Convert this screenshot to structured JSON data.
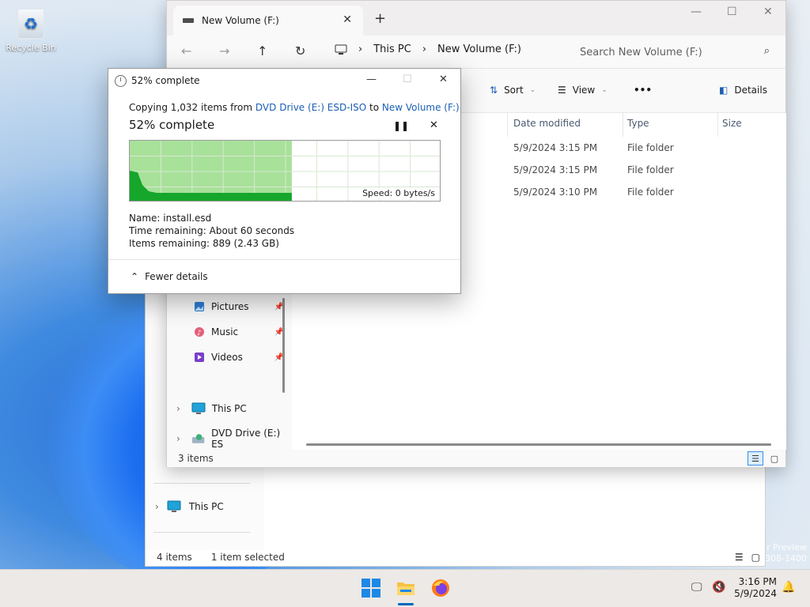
{
  "desktop": {
    "recycle_bin_label": "Recycle Bin",
    "watermark_line1": "r Preview",
    "watermark_line2": "0308-1400"
  },
  "back_window": {
    "sidebar_this_pc": "This PC",
    "status_items": "4 items",
    "status_selected": "1 item selected"
  },
  "explorer": {
    "tab_title": "New Volume (F:)",
    "new_tab_symbol": "+",
    "breadcrumb": [
      "This PC",
      "New Volume (F:)"
    ],
    "search_placeholder": "Search New Volume (F:)",
    "toolbar": {
      "sort_label": "Sort",
      "view_label": "View",
      "more_label": "•••",
      "details_label": "Details"
    },
    "columns": [
      "Date modified",
      "Type",
      "Size"
    ],
    "rows": [
      {
        "date": "5/9/2024 3:15 PM",
        "type": "File folder"
      },
      {
        "date": "5/9/2024 3:15 PM",
        "type": "File folder"
      },
      {
        "date": "5/9/2024 3:10 PM",
        "type": "File folder"
      }
    ],
    "sidebar": {
      "pinned": [
        "Pictures",
        "Music",
        "Videos"
      ],
      "this_pc": "This PC",
      "dvd_drive": "DVD Drive (E:) ES"
    },
    "status_count": "3 items"
  },
  "dialog": {
    "title": "52% complete",
    "copy_prefix": "Copying 1,032 items from ",
    "source": "DVD Drive (E:) ESD-ISO",
    "to_word": " to ",
    "destination": "New Volume (F:)",
    "percent_heading": "52% complete",
    "progress_fraction": 0.52,
    "speed_label": "Speed: 0 bytes/s",
    "name_line": "Name:  install.esd",
    "time_line": "Time remaining:  About 60 seconds",
    "items_line": "Items remaining:  889 (2.43 GB)",
    "fewer_details": "Fewer details",
    "colors": {
      "fill_light": "#a8e19a",
      "fill_dark": "#16a62b"
    }
  },
  "taskbar": {
    "time": "3:16 PM",
    "date": "5/9/2024"
  }
}
